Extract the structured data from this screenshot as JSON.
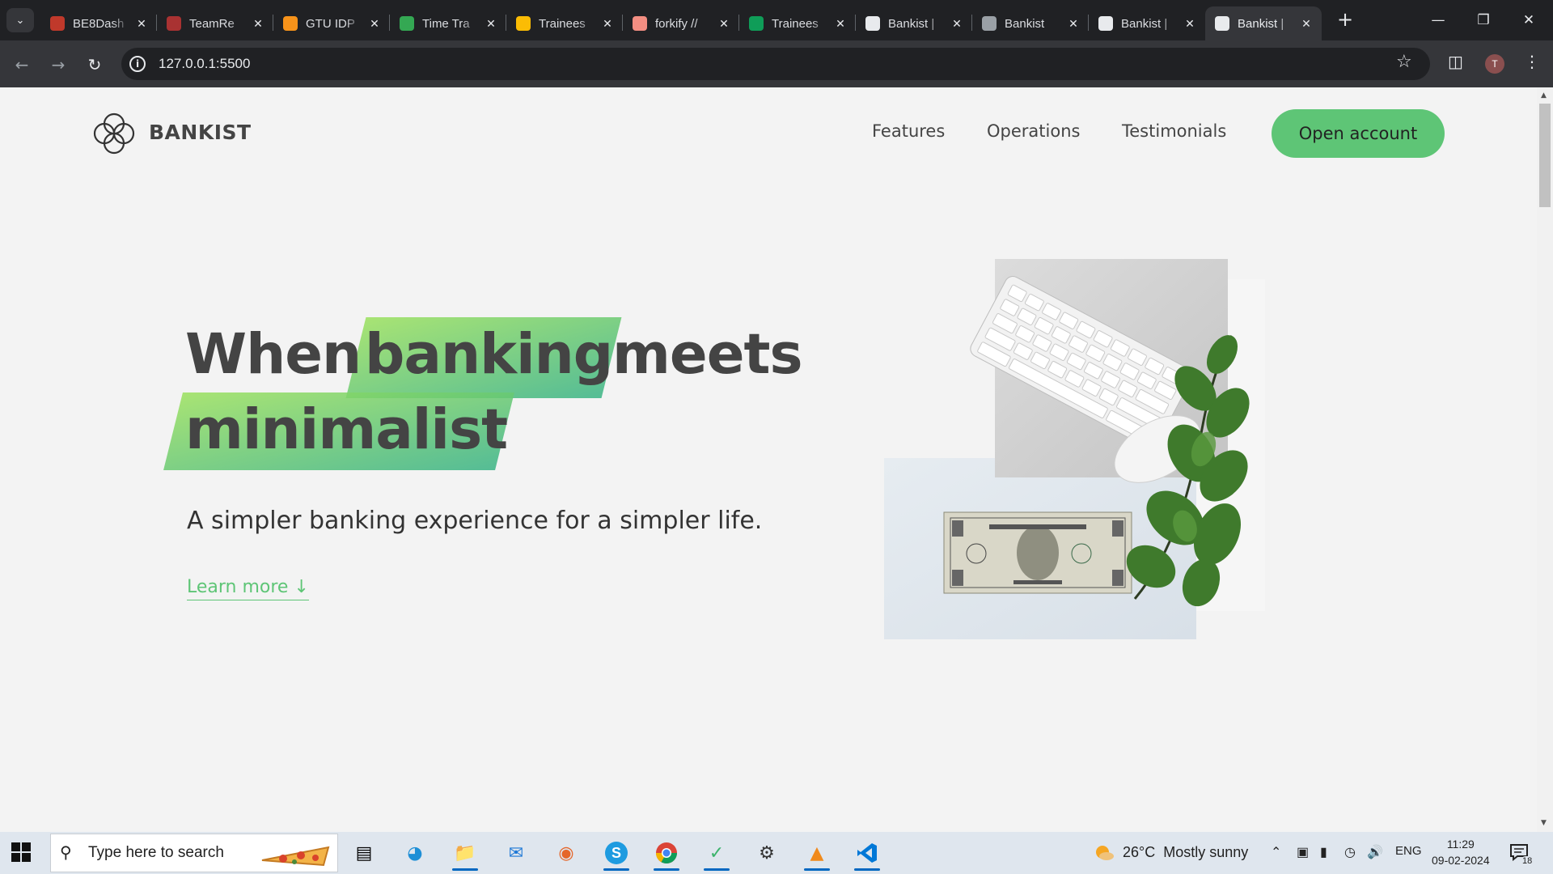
{
  "browser": {
    "tabs": [
      {
        "title": "BE8Dash",
        "favicon": "red-logo-icon",
        "color": "#c0392b"
      },
      {
        "title": "TeamRe",
        "favicon": "red-logo-icon",
        "color": "#a93232"
      },
      {
        "title": "GTU IDP",
        "favicon": "bitcoin-orange-icon",
        "color": "#f7931a"
      },
      {
        "title": "Time Tra",
        "favicon": "clock-check-green-icon",
        "color": "#34a853"
      },
      {
        "title": "Trainees",
        "favicon": "google-drive-icon",
        "color": "#fbbc04"
      },
      {
        "title": "forkify //",
        "favicon": "forkify-orange-icon",
        "color": "#f38e82"
      },
      {
        "title": "Trainees",
        "favicon": "google-sheets-icon",
        "color": "#0f9d58"
      },
      {
        "title": "Bankist |",
        "favicon": "bankist-logo-icon",
        "color": "#e8eaed"
      },
      {
        "title": "Bankist",
        "favicon": "globe-icon",
        "color": "#9aa0a6"
      },
      {
        "title": "Bankist |",
        "favicon": "bankist-logo-icon",
        "color": "#e8eaed"
      },
      {
        "title": "Bankist |",
        "favicon": "bankist-logo-icon",
        "color": "#e8eaed",
        "active": true
      }
    ],
    "url": "127.0.0.1:5500",
    "profile_initial": "T"
  },
  "page": {
    "brand": "BANKIST",
    "nav": {
      "features": "Features",
      "operations": "Operations",
      "testimonials": "Testimonials",
      "cta": "Open account"
    },
    "hero": {
      "word1": "When",
      "word2": "banking",
      "word3": "meets",
      "word4": "minimalist",
      "subtitle": "A simpler banking experience for a simpler life.",
      "learn_more": "Learn more ↓"
    },
    "accent_color": "#5ec576",
    "highlight_gradient": [
      "#39b385",
      "#9be15d"
    ]
  },
  "taskbar": {
    "search_placeholder": "Type here to search",
    "weather_temp": "26°C",
    "weather_text": "Mostly sunny",
    "language": "ENG",
    "time": "11:29",
    "date": "09-02-2024",
    "notification_count": "18"
  }
}
